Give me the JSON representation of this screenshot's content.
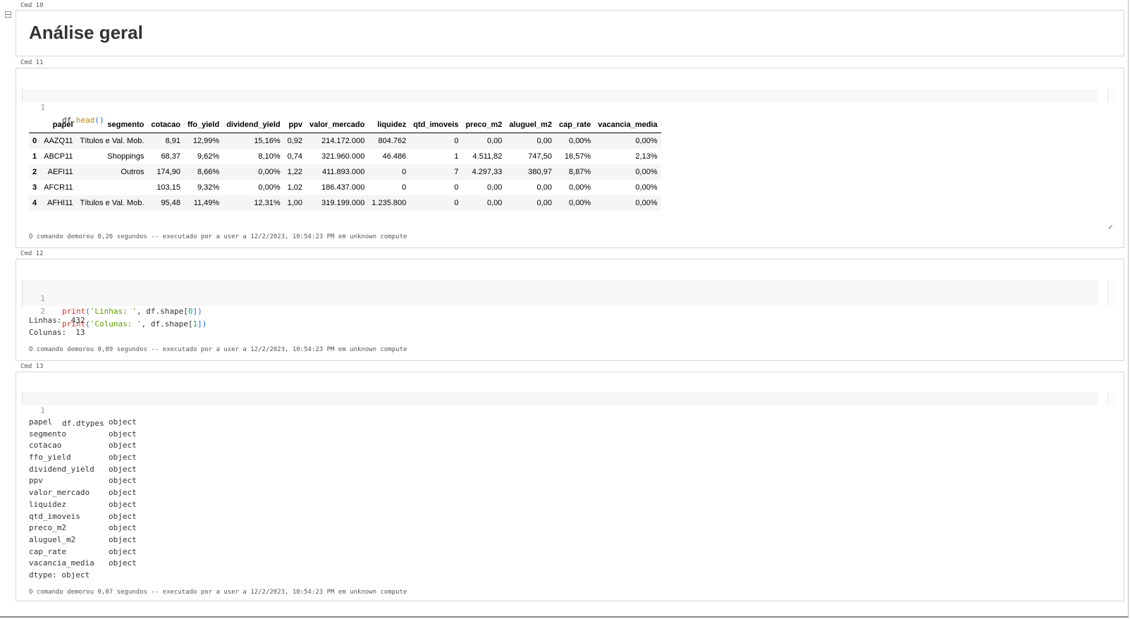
{
  "cells": [
    {
      "label": "Cmd 10",
      "markdown_title": "Análise geral"
    },
    {
      "label": "Cmd 11",
      "code": [
        {
          "num": "1",
          "obj": "df.",
          "fn": "head",
          "paren": "()"
        }
      ],
      "table": {
        "columns": [
          "",
          "papel",
          "segmento",
          "cotacao",
          "ffo_yield",
          "dividend_yield",
          "ppv",
          "valor_mercado",
          "liquidez",
          "qtd_imoveis",
          "preco_m2",
          "aluguel_m2",
          "cap_rate",
          "vacancia_media"
        ],
        "rows": [
          [
            "0",
            "AAZQ11",
            "Títulos e Val. Mob.",
            "8,91",
            "12,99%",
            "15,16%",
            "0,92",
            "214.172.000",
            "804.762",
            "0",
            "0,00",
            "0,00",
            "0,00%",
            "0,00%"
          ],
          [
            "1",
            "ABCP11",
            "Shoppings",
            "68,37",
            "9,62%",
            "8,10%",
            "0,74",
            "321.960.000",
            "46.486",
            "1",
            "4.511,82",
            "747,50",
            "16,57%",
            "2,13%"
          ],
          [
            "2",
            "AEFI11",
            "Outros",
            "174,90",
            "8,66%",
            "0,00%",
            "1,22",
            "411.893.000",
            "0",
            "7",
            "4.297,33",
            "380,97",
            "8,87%",
            "0,00%"
          ],
          [
            "3",
            "AFCR11",
            "",
            "103,15",
            "9,32%",
            "0,00%",
            "1,02",
            "186.437.000",
            "0",
            "0",
            "0,00",
            "0,00",
            "0,00%",
            "0,00%"
          ],
          [
            "4",
            "AFHI11",
            "Títulos e Val. Mob.",
            "95,48",
            "11,49%",
            "12,31%",
            "1,00",
            "319.199.000",
            "1.235.800",
            "0",
            "0,00",
            "0,00",
            "0,00%",
            "0,00%"
          ]
        ]
      },
      "footer": "O comando demorou 0,26 segundos -- executado por a user a 12/2/2023, 10:54:23 PM em unknown compute"
    },
    {
      "label": "Cmd 12",
      "code": [
        {
          "num": "1",
          "kw": "print",
          "p1": "(",
          "str": "'Linhas: '",
          "mid": ", df.shape[",
          "idx": "0",
          "end": "])"
        },
        {
          "num": "2",
          "kw": "print",
          "p1": "(",
          "str": "'Colunas: '",
          "mid": ", df.shape[",
          "idx": "1",
          "end": "])"
        }
      ],
      "output": [
        "Linhas:  432",
        "Colunas:  13"
      ],
      "footer": "O comando demorou 0,09 segundos -- executado por a user a 12/2/2023, 10:54:23 PM em unknown compute"
    },
    {
      "label": "Cmd 13",
      "code": [
        {
          "num": "1",
          "text": "df.dtypes"
        }
      ],
      "dtypes": [
        [
          "papel",
          "object"
        ],
        [
          "segmento",
          "object"
        ],
        [
          "cotacao",
          "object"
        ],
        [
          "ffo_yield",
          "object"
        ],
        [
          "dividend_yield",
          "object"
        ],
        [
          "ppv",
          "object"
        ],
        [
          "valor_mercado",
          "object"
        ],
        [
          "liquidez",
          "object"
        ],
        [
          "qtd_imoveis",
          "object"
        ],
        [
          "preco_m2",
          "object"
        ],
        [
          "aluguel_m2",
          "object"
        ],
        [
          "cap_rate",
          "object"
        ],
        [
          "vacancia_media",
          "object"
        ]
      ],
      "dtype_footer": "dtype: object",
      "footer": "O comando demorou 0,07 segundos -- executado por a user a 12/2/2023, 10:54:23 PM em unknown compute"
    }
  ]
}
